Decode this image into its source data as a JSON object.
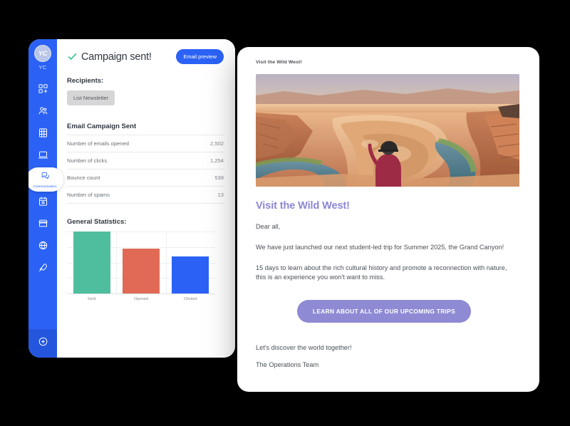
{
  "sidebar": {
    "brand": {
      "monogram": "YC",
      "label": "YC"
    },
    "items": [
      {
        "name": "dashboard",
        "icon": "grid-plus-icon",
        "label": ""
      },
      {
        "name": "contacts",
        "icon": "people-icon",
        "label": ""
      },
      {
        "name": "accounting",
        "icon": "calculator-icon",
        "label": ""
      },
      {
        "name": "website",
        "icon": "laptop-icon",
        "label": ""
      },
      {
        "name": "communication",
        "icon": "chat-bubble-icon",
        "label": "Communication",
        "active": true
      },
      {
        "name": "calendar",
        "icon": "calendar-icon",
        "label": ""
      },
      {
        "name": "store",
        "icon": "storefront-icon",
        "label": ""
      },
      {
        "name": "globe",
        "icon": "globe-icon",
        "label": ""
      },
      {
        "name": "launch",
        "icon": "rocket-icon",
        "label": ""
      }
    ],
    "add_button": {
      "icon": "plus-circle-icon"
    }
  },
  "main": {
    "page_title": "Campaign sent!",
    "preview_button": "Email preview",
    "recipients_label": "Recipients:",
    "recipient_chip": "List Newsletter",
    "table_title": "Email Campaign Sent",
    "stats": [
      {
        "label": "Number of emails opened",
        "value": "2,502"
      },
      {
        "label": "Number of clicks",
        "value": "1,254"
      },
      {
        "label": "Bounce count",
        "value": "539"
      },
      {
        "label": "Number of spams",
        "value": "13"
      }
    ],
    "chart_title": "General Statistics:"
  },
  "chart_data": {
    "type": "bar",
    "title": "General Statistics:",
    "categories": [
      "Sent",
      "Opened",
      "Clicked"
    ],
    "values": [
      100,
      72,
      60
    ],
    "colors": [
      "#4FBE9F",
      "#E06A55",
      "#2B62F5"
    ],
    "xlabel": "",
    "ylabel": "",
    "ylim": [
      0,
      100
    ],
    "grid": true,
    "legend": "none"
  },
  "email_preview": {
    "subject": "Visit the Wild West!",
    "hero_image": "grand-canyon-horseshoe-bend-photo",
    "heading": "Visit the Wild West!",
    "greeting": "Dear all,",
    "paragraph_1": "We have just launched our next student-led trip for Summer 2025, the Grand Canyon!",
    "paragraph_2": "15 days to learn about the rich cultural history and promote a reconnection with nature, this is an experience you won't want to miss.",
    "cta_label": "LEARN ABOUT ALL OF OUR UPCOMING TRIPS",
    "closing": "Let's discover the world together!",
    "signature": "The Operations Team"
  },
  "colors": {
    "brand_blue": "#2B62F5",
    "success_green": "#21c38a",
    "cta_purple": "#8e8ad4",
    "bar_teal": "#4FBE9F",
    "bar_coral": "#E06A55",
    "bar_blue": "#2B62F5"
  }
}
